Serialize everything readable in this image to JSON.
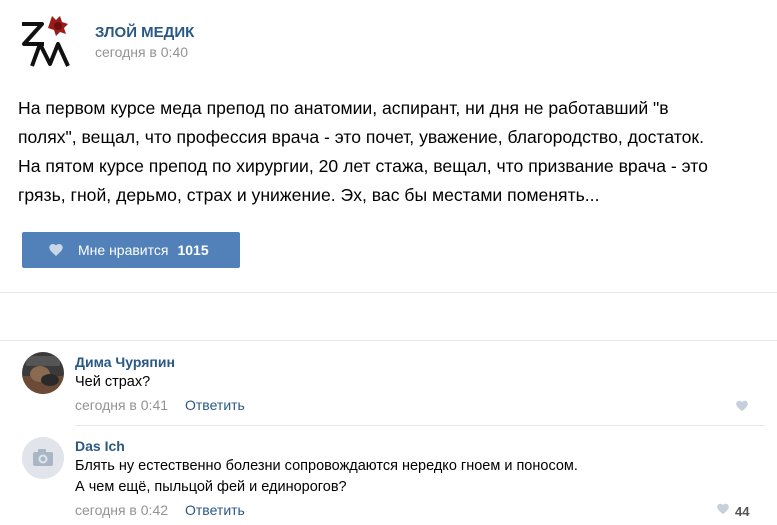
{
  "post": {
    "group_name": "ЗЛОЙ МЕДИК",
    "time": "сегодня в 0:40",
    "logo_icon": "zm-logo-icon",
    "text_lines": [
      "На первом курсе меда препод по анатомии, аспирант, ни дня не работавший \"в",
      "полях\", вещал, что профессия врача - это почет, уважение, благородство, достаток.",
      "На пятом курсе препод по хирургии, 20 лет стажа, вещал, что призвание врача - это",
      "грязь, гной, дерьмо, страх и унижение. Эх, вас бы местами поменять..."
    ],
    "like_label": "Мне нравится",
    "like_count": "1015",
    "accent_color": "#5181b8"
  },
  "comments": [
    {
      "author": "Дима Чуряпин",
      "text_lines": [
        "Чей страх?"
      ],
      "time": "сегодня в 0:41",
      "reply_label": "Ответить",
      "likes": ""
    },
    {
      "author": "Das Ich",
      "text_lines": [
        "Блять ну естественно болезни сопровождаются нередко гноем и поносом.",
        "А чем ещё, пыльцой фей и единорогов?"
      ],
      "time": "сегодня в 0:42",
      "reply_label": "Ответить",
      "likes": "44"
    }
  ],
  "colors": {
    "link": "#2a5885",
    "muted": "#939393",
    "divider": "#e7e8ec"
  }
}
